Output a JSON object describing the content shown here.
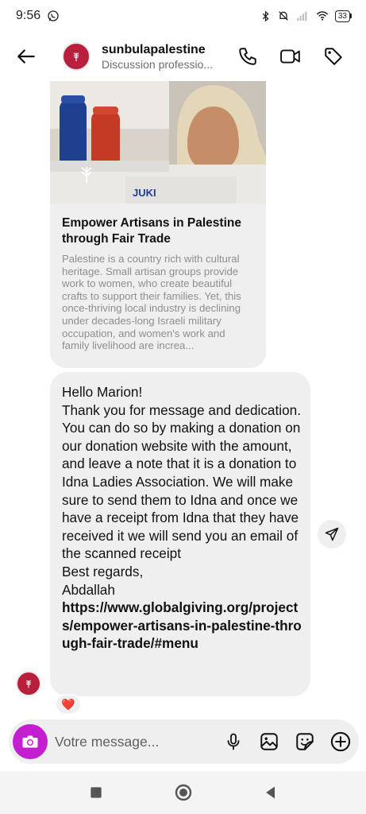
{
  "status_bar": {
    "time": "9:56",
    "battery": "33"
  },
  "header": {
    "name": "sunbulapalestine",
    "subtitle": "Discussion professio..."
  },
  "link_card": {
    "image_text": "JUKI",
    "title": "Empower Artisans in Palestine through Fair Trade",
    "description": "Palestine is a country rich with cultural heritage. Small artisan groups provide work to women, who create beautiful crafts to support their families. Yet, this once-thriving local industry is declining under decades-long Israeli military occupation, and women's work and family livelihood are increa..."
  },
  "message": {
    "text": "Hello Marion!\nThank you for message and dedication. You can do so by making a donation on our donation website with the amount, and leave a note that it is a donation to Idna Ladies Association. We will make sure to send them to Idna and once we have a receipt from Idna that they have received it we will send you an email of the scanned receipt\nBest regards,\nAbdallah",
    "link": "https://www.globalgiving.org/projects/empower-artisans-in-palestine-through-fair-trade/#menu",
    "reaction": "❤️"
  },
  "composer": {
    "placeholder": "Votre message..."
  },
  "colors": {
    "brand_avatar": "#b81f3c",
    "camera_button": "#c31ed0",
    "bubble": "#efefef"
  },
  "icons": {
    "back": "arrow-left-icon",
    "call": "phone-icon",
    "video": "video-camera-icon",
    "tag": "tag-icon",
    "share": "send-icon",
    "camera": "camera-icon",
    "mic": "microphone-icon",
    "gallery": "image-icon",
    "sticker": "sticker-icon",
    "add": "plus-circle-icon"
  }
}
